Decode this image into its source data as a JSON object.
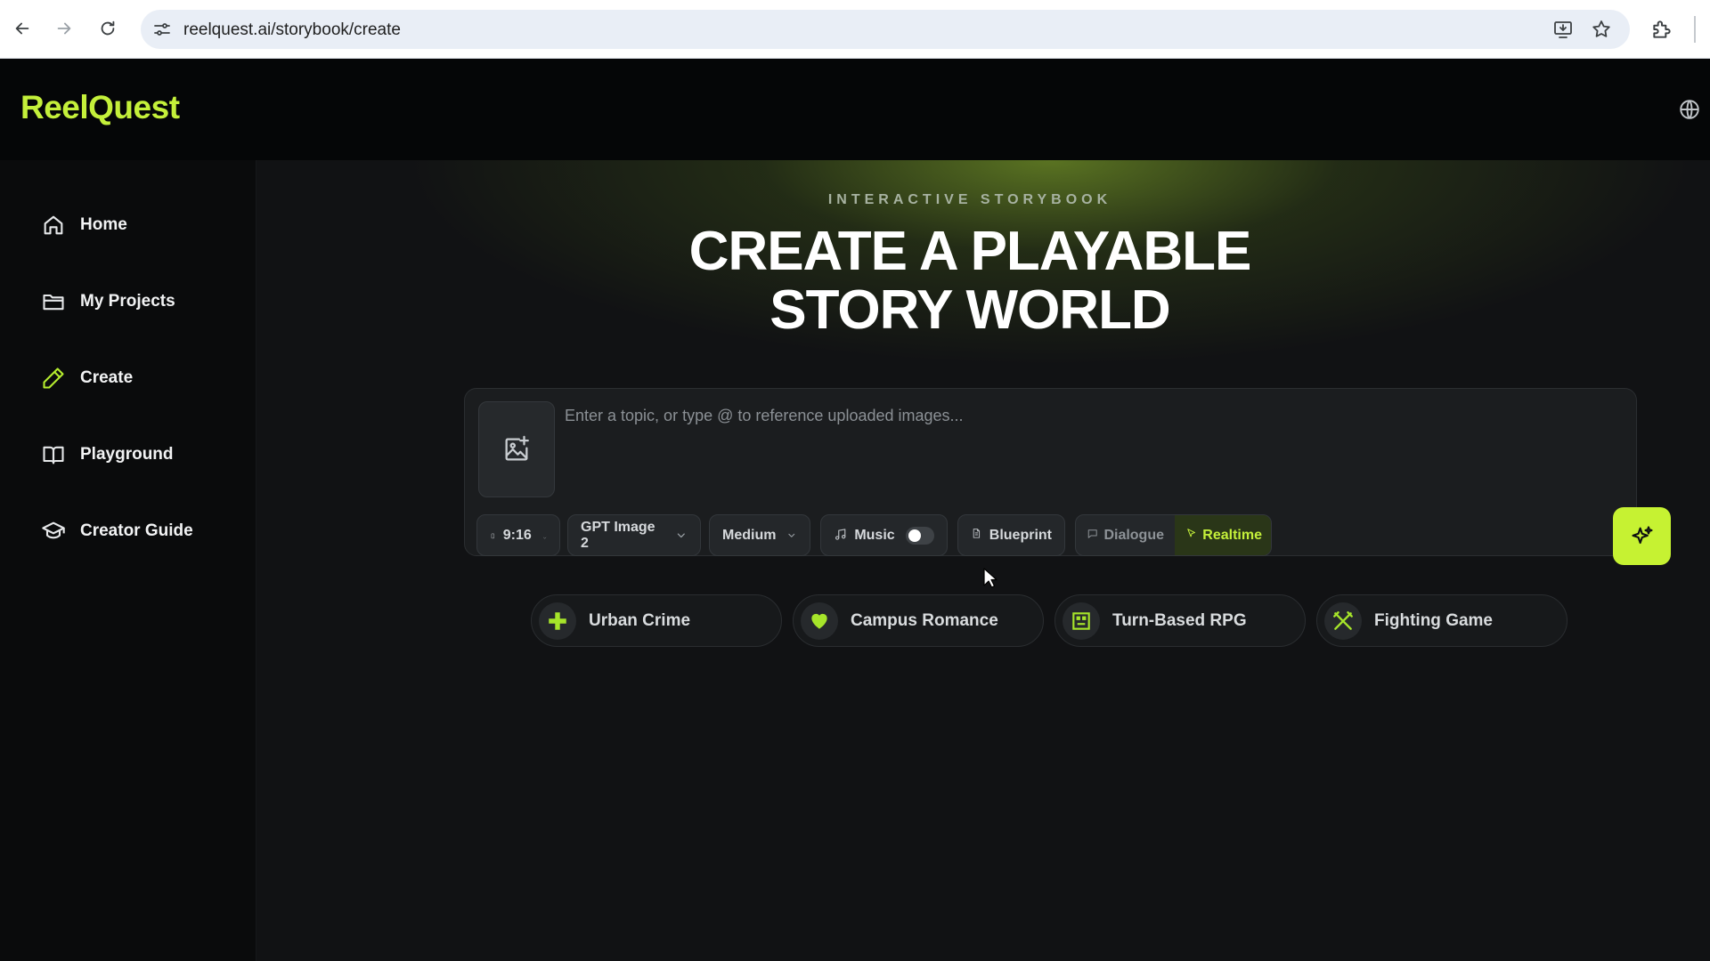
{
  "browser": {
    "url": "reelquest.ai/storybook/create",
    "icons": [
      "back-arrow-icon",
      "forward-arrow-icon",
      "reload-icon",
      "site-settings-icon",
      "install-app-icon",
      "bookmark-star-icon",
      "extensions-icon"
    ]
  },
  "app": {
    "logo": "ReelQuest",
    "brand_color": "#c4f03a",
    "language_icon": "globe-icon"
  },
  "sidebar": {
    "items": [
      {
        "label": "Home",
        "icon": "home-icon"
      },
      {
        "label": "My Projects",
        "icon": "folder-icon"
      },
      {
        "label": "Create",
        "icon": "pencil-icon",
        "active": true
      },
      {
        "label": "Playground",
        "icon": "book-open-icon"
      },
      {
        "label": "Creator Guide",
        "icon": "graduation-cap-icon"
      }
    ]
  },
  "hero": {
    "eyebrow": "INTERACTIVE STORYBOOK",
    "title_line1": "CREATE A PLAYABLE",
    "title_line2": "STORY WORLD"
  },
  "composer": {
    "placeholder": "Enter a topic, or type @ to reference uploaded images...",
    "value": "",
    "upload_icon": "image-add-icon",
    "aspect_ratio": "9:16",
    "model": "GPT Image 2",
    "quality": "Medium",
    "music_label": "Music",
    "music_enabled": false,
    "blueprint_label": "Blueprint",
    "mode_options": [
      "Dialogue",
      "Realtime"
    ],
    "mode_selected": "Realtime",
    "generate_icon": "sparkles-icon"
  },
  "templates": [
    {
      "label": "Urban Crime",
      "icon": "cross-icon"
    },
    {
      "label": "Campus Romance",
      "icon": "heart-icon"
    },
    {
      "label": "Turn-Based RPG",
      "icon": "pixel-face-icon"
    },
    {
      "label": "Fighting Game",
      "icon": "crossed-swords-icon"
    }
  ]
}
